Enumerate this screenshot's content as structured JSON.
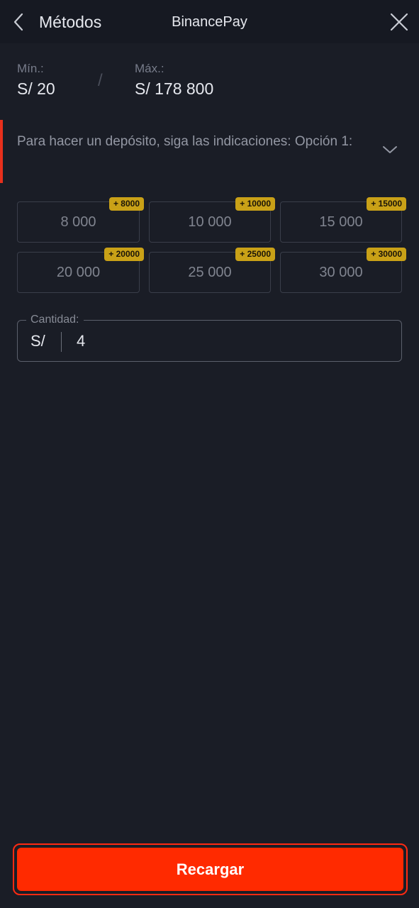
{
  "header": {
    "back_label": "Métodos",
    "title": "BinancePay",
    "back_icon": "chevron-left-icon",
    "close_icon": "close-icon"
  },
  "limits": {
    "min_label": "Mín.:",
    "min_value": "S/ 20",
    "separator": "/",
    "max_label": "Máx.:",
    "max_value": "S/ 178 800"
  },
  "instructions": {
    "text": "Para hacer un depósito, siga las indicaciones: Opción 1:",
    "expand_icon": "chevron-down-icon"
  },
  "presets": [
    {
      "amount": "8 000",
      "bonus": "+ 8000"
    },
    {
      "amount": "10 000",
      "bonus": "+ 10000"
    },
    {
      "amount": "15 000",
      "bonus": "+ 15000"
    },
    {
      "amount": "20 000",
      "bonus": "+ 20000"
    },
    {
      "amount": "25 000",
      "bonus": "+ 25000"
    },
    {
      "amount": "30 000",
      "bonus": "+ 30000"
    }
  ],
  "amount_field": {
    "label": "Cantidad:",
    "currency": "S/",
    "value": "4"
  },
  "submit": {
    "label": "Recargar"
  },
  "colors": {
    "background": "#1a1d26",
    "header": "#161922",
    "accent": "#ff2a00",
    "badge": "#c9a117"
  }
}
